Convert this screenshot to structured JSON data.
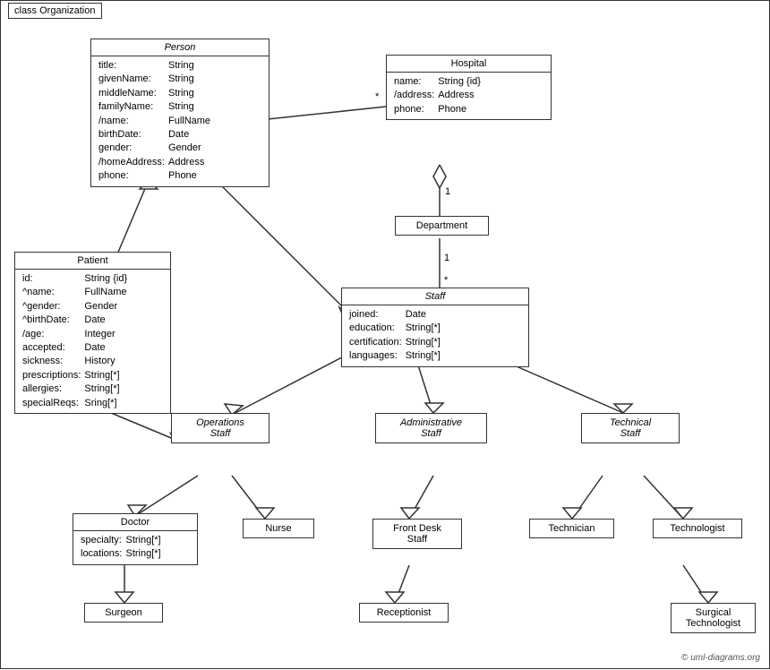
{
  "diagram": {
    "title": "class Organization",
    "classes": {
      "person": {
        "name": "Person",
        "italic": true,
        "attributes": [
          [
            "title:",
            "String"
          ],
          [
            "givenName:",
            "String"
          ],
          [
            "middleName:",
            "String"
          ],
          [
            "familyName:",
            "String"
          ],
          [
            "/name:",
            "FullName"
          ],
          [
            "birthDate:",
            "Date"
          ],
          [
            "gender:",
            "Gender"
          ],
          [
            "/homeAddress:",
            "Address"
          ],
          [
            "phone:",
            "Phone"
          ]
        ]
      },
      "hospital": {
        "name": "Hospital",
        "italic": false,
        "attributes": [
          [
            "name:",
            "String {id}"
          ],
          [
            "/address:",
            "Address"
          ],
          [
            "phone:",
            "Phone"
          ]
        ]
      },
      "patient": {
        "name": "Patient",
        "italic": false,
        "attributes": [
          [
            "id:",
            "String {id}"
          ],
          [
            "^name:",
            "FullName"
          ],
          [
            "^gender:",
            "Gender"
          ],
          [
            "^birthDate:",
            "Date"
          ],
          [
            "/age:",
            "Integer"
          ],
          [
            "accepted:",
            "Date"
          ],
          [
            "sickness:",
            "History"
          ],
          [
            "prescriptions:",
            "String[*]"
          ],
          [
            "allergies:",
            "String[*]"
          ],
          [
            "specialReqs:",
            "Sring[*]"
          ]
        ]
      },
      "department": {
        "name": "Department"
      },
      "staff": {
        "name": "Staff",
        "italic": true,
        "attributes": [
          [
            "joined:",
            "Date"
          ],
          [
            "education:",
            "String[*]"
          ],
          [
            "certification:",
            "String[*]"
          ],
          [
            "languages:",
            "String[*]"
          ]
        ]
      },
      "operations_staff": {
        "name": "Operations\nStaff",
        "italic": true
      },
      "administrative_staff": {
        "name": "Administrative\nStaff",
        "italic": true
      },
      "technical_staff": {
        "name": "Technical\nStaff",
        "italic": true
      },
      "doctor": {
        "name": "Doctor",
        "attributes": [
          [
            "specialty:",
            "String[*]"
          ],
          [
            "locations:",
            "String[*]"
          ]
        ]
      },
      "nurse": {
        "name": "Nurse"
      },
      "front_desk_staff": {
        "name": "Front Desk\nStaff"
      },
      "technician": {
        "name": "Technician"
      },
      "technologist": {
        "name": "Technologist"
      },
      "surgeon": {
        "name": "Surgeon"
      },
      "receptionist": {
        "name": "Receptionist"
      },
      "surgical_technologist": {
        "name": "Surgical\nTechnologist"
      }
    },
    "copyright": "© uml-diagrams.org"
  }
}
